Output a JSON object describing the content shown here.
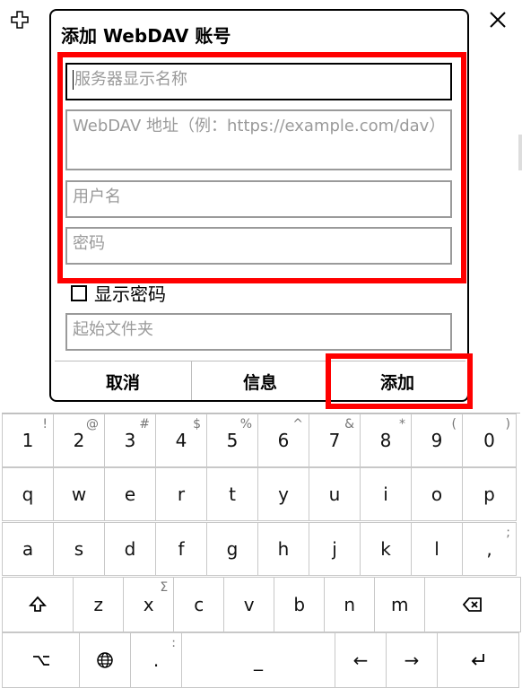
{
  "dialog": {
    "title": "添加 WebDAV 账号",
    "fields": {
      "server_name_placeholder": "服务器显示名称",
      "url_placeholder": "WebDAV 地址（例：https://example.com/dav）",
      "username_placeholder": "用户名",
      "password_placeholder": "密码",
      "start_folder_placeholder": "起始文件夹"
    },
    "show_password_label": "显示密码",
    "buttons": {
      "cancel": "取消",
      "info": "信息",
      "add": "添加"
    }
  },
  "highlight_color": "#ff0000",
  "keyboard": {
    "row1": [
      {
        "main": "1",
        "sub": "!"
      },
      {
        "main": "2",
        "sub": "@"
      },
      {
        "main": "3",
        "sub": "#"
      },
      {
        "main": "4",
        "sub": "$"
      },
      {
        "main": "5",
        "sub": "%"
      },
      {
        "main": "6",
        "sub": "^"
      },
      {
        "main": "7",
        "sub": "&"
      },
      {
        "main": "8",
        "sub": "*"
      },
      {
        "main": "9",
        "sub": "("
      },
      {
        "main": "0",
        "sub": ")"
      }
    ],
    "row2": [
      "q",
      "w",
      "e",
      "r",
      "t",
      "y",
      "u",
      "i",
      "o",
      "p"
    ],
    "row3": [
      {
        "main": "a",
        "sub": ""
      },
      {
        "main": "s",
        "sub": ""
      },
      {
        "main": "d",
        "sub": ""
      },
      {
        "main": "f",
        "sub": ""
      },
      {
        "main": "g",
        "sub": ""
      },
      {
        "main": "h",
        "sub": ""
      },
      {
        "main": "j",
        "sub": ""
      },
      {
        "main": "k",
        "sub": ""
      },
      {
        "main": "l",
        "sub": ""
      },
      {
        "main": ",",
        "sub": ";"
      }
    ],
    "row4": [
      {
        "main": "z",
        "sub": ""
      },
      {
        "main": "x",
        "sub": "Σ"
      },
      {
        "main": "c",
        "sub": ""
      },
      {
        "main": "v",
        "sub": ""
      },
      {
        "main": "b",
        "sub": ""
      },
      {
        "main": "n",
        "sub": ""
      },
      {
        "main": "m",
        "sub": ""
      }
    ],
    "row5": {
      "dot": ".",
      "dot_sub": ":",
      "space": "_",
      "left_arrow": "←",
      "right_arrow": "→"
    },
    "icons": {
      "shift": "shift-icon",
      "backspace": "backspace-icon",
      "symbols": "option-icon",
      "language": "globe-icon",
      "enter": "enter-icon"
    }
  }
}
